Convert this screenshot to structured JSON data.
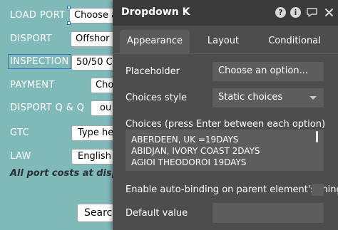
{
  "form": {
    "labels": {
      "load_port": "LOAD PORT",
      "disport": "DISPORT",
      "inspection": "INSPECTION",
      "payment": "PAYMENT",
      "disport_qq": "DISPORT Q & Q",
      "gtc": "GTC",
      "law": "LAW"
    },
    "fields": {
      "load_port_value": "Choose a",
      "disport_value": "Offshor",
      "inspection_value": "50/50 C",
      "payment_value": "Cho",
      "disport_qq_value": "ou",
      "gtc_value": "Type he",
      "law_value": "English"
    },
    "note": "All port costs at dispo",
    "search_button": "Search"
  },
  "panel": {
    "title": "Dropdown K",
    "header_icons": [
      "help-icon",
      "info-icon",
      "comment-icon",
      "close-icon"
    ],
    "tabs": {
      "appearance": "Appearance",
      "layout": "Layout",
      "conditional": "Conditional"
    },
    "placeholder_label": "Placeholder",
    "placeholder_value": "Choose an option...",
    "choices_style_label": "Choices style",
    "choices_style_value": "Static choices",
    "choices_label": "Choices (press Enter between each option)",
    "choices": [
      "ABERDEEN, UK =19DAYS",
      "ABIDJAN, IVORY COAST 2DAYS",
      "AGIOI THEODOROI 19DAYS"
    ],
    "auto_binding_label": "Enable auto-binding on parent element's thing",
    "auto_binding_checked": false,
    "default_value_label": "Default value",
    "default_value": ""
  },
  "colors": {
    "canvas_bg": "#7fb9b8",
    "panel_bg": "#4d4d4d",
    "panel_header_bg": "#3b3b3b",
    "input_bg": "#5d5d5d",
    "selection_outline": "#2f6fd6"
  }
}
